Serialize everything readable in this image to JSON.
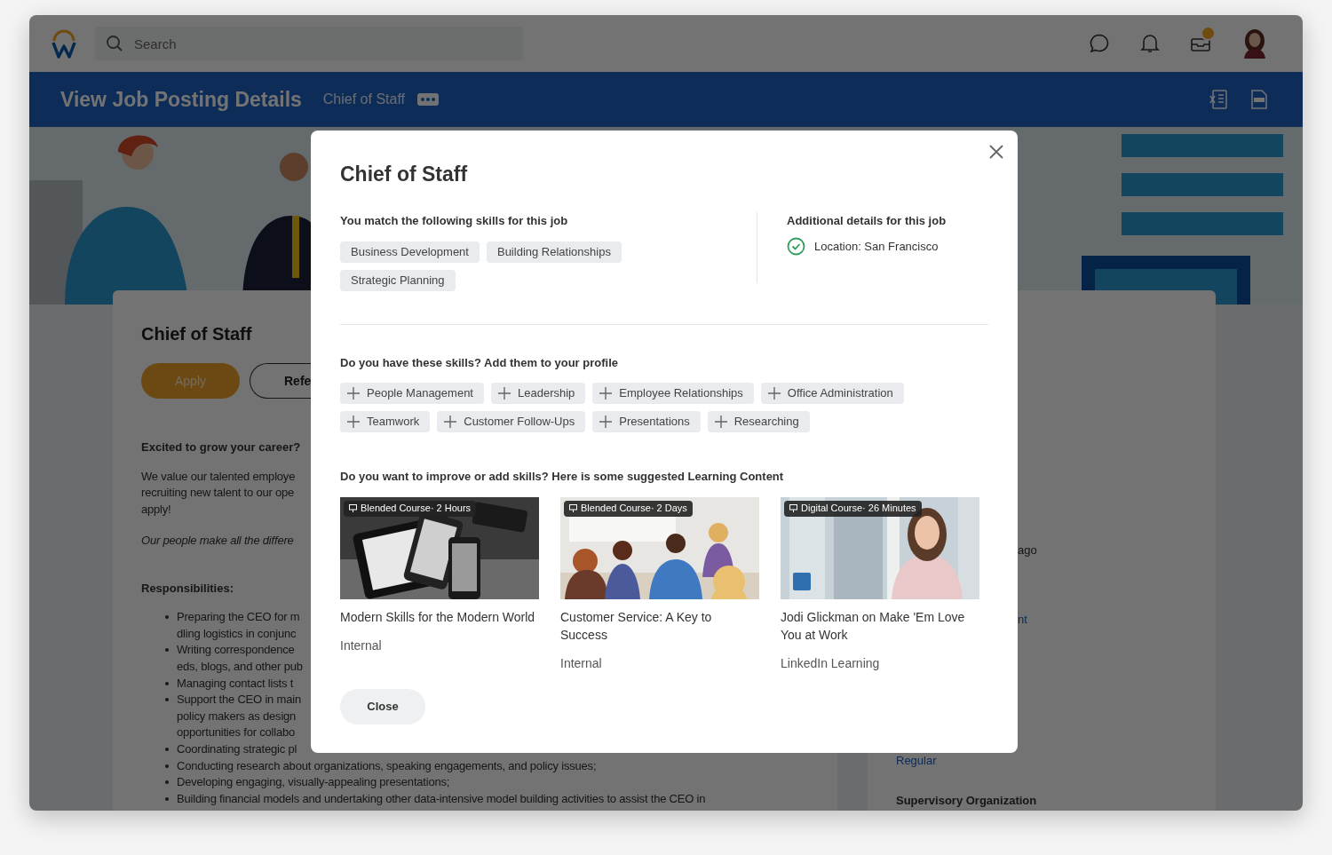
{
  "top_bar": {
    "search": {
      "placeholder": "Search"
    }
  },
  "header": {
    "title": "View Job Posting Details",
    "subtitle": "Chief of Staff"
  },
  "job_card": {
    "title": "Chief of Staff",
    "buttons": [
      {
        "label": "Apply",
        "kind": "primary"
      },
      {
        "label": "Refe",
        "kind": "outline"
      }
    ],
    "heading": "Excited to grow your career?",
    "paragraph_lines": [
      "We value our talented employe",
      "recruiting new talent to our ope",
      "apply!"
    ],
    "tagline": "Our people make all the differe",
    "responsibilities_heading": "Responsibilities:",
    "responsibilities": [
      {
        "lines": [
          "Preparing the CEO for m",
          "dling logistics in conjunc"
        ]
      },
      {
        "lines": [
          "Writing correspondence",
          "eds, blogs, and other pub"
        ]
      },
      {
        "lines": [
          "Managing contact lists t"
        ]
      },
      {
        "lines": [
          "Support the CEO in main",
          "policy makers as design",
          "opportunities for collabo"
        ]
      },
      {
        "lines": [
          "Coordinating strategic pl"
        ]
      },
      {
        "lines": [
          "Conducting research about organizations, speaking engagements, and policy issues;"
        ]
      },
      {
        "lines": [
          "Developing engaging, visually-appealing presentations;"
        ]
      },
      {
        "lines": [
          "Building financial models and undertaking other data-intensive model building activities to assist the CEO in"
        ]
      }
    ]
  },
  "side_card": {
    "fragments": [
      "ago",
      "nt"
    ],
    "link": "Regular",
    "label": "Supervisory Organization"
  },
  "modal": {
    "title": "Chief of Staff",
    "matched_heading": "You match the following skills for this job",
    "matched_skills": [
      "Business Development",
      "Building Relationships",
      "Strategic Planning"
    ],
    "details_heading": "Additional details for this job",
    "details": [
      "Location: San Francisco"
    ],
    "suggest_heading": "Do you have these skills? Add them to your profile",
    "suggested_skills": [
      "People Management",
      "Leadership",
      "Employee Relationships",
      "Office Administration",
      "Teamwork",
      "Customer Follow-Ups",
      "Presentations",
      "Researching"
    ],
    "learning_heading": "Do you want to improve or add skills? Here is some suggested Learning Content",
    "courses": [
      {
        "badge": "Blended Course· 2 Hours",
        "title": "Modern Skills for the Modern World",
        "source": "Internal",
        "kind": "picture"
      },
      {
        "badge": "Blended Course· 2 Days",
        "title": "Customer Service: A Key to Success",
        "source": "Internal",
        "kind": "picture"
      },
      {
        "badge": "Digital Course· 26 Minutes",
        "title": "Jodi Glickman on Make 'Em Love You at Work",
        "source": "LinkedIn Learning",
        "kind": "picture"
      }
    ],
    "close_button": "Close"
  }
}
